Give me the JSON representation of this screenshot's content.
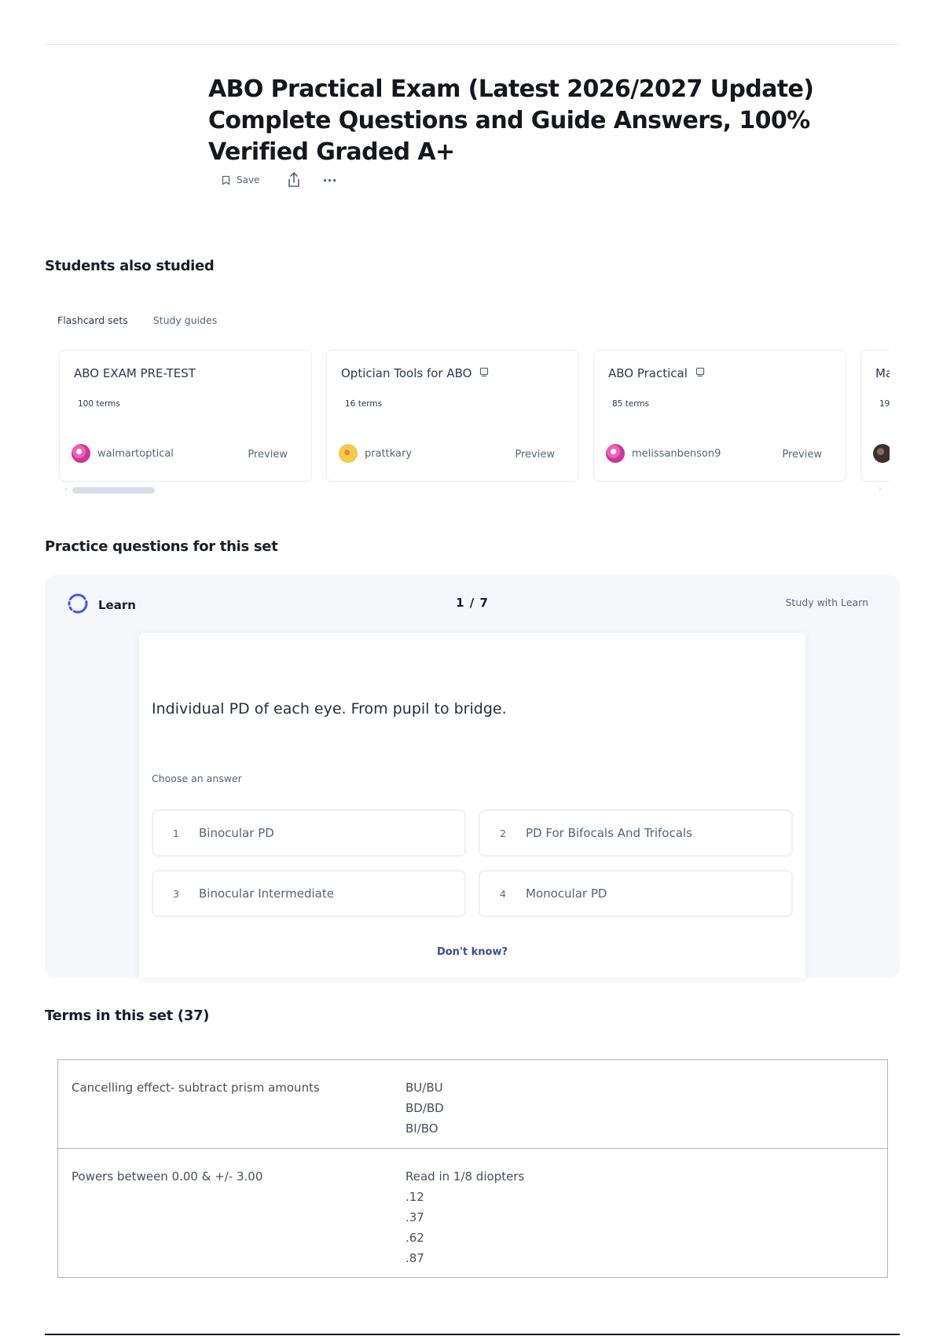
{
  "document": {
    "title": "ABO Practical Exam (Latest 2026/2027 Update) Complete Questions and Guide Answers, 100% Verified Graded A+"
  },
  "actions": {
    "save_label": "Save",
    "more_label": "···"
  },
  "students_also_studied": {
    "heading": "Students also studied",
    "tabs": [
      "Flashcard sets",
      "Study guides"
    ],
    "cards": [
      {
        "title": "ABO EXAM PRE-TEST",
        "terms": "100 terms",
        "user": "walmartoptical",
        "preview": "Preview"
      },
      {
        "title": "Optician Tools for ABO",
        "terms": "16 terms",
        "user": "prattkary",
        "preview": "Preview"
      },
      {
        "title": "ABO Practical",
        "terms": "85 terms",
        "user": "melissanbenson9",
        "preview": "Preview"
      },
      {
        "title": "Ma",
        "terms": "19",
        "user": "",
        "preview": ""
      }
    ]
  },
  "practice": {
    "heading": "Practice questions for this set",
    "mode_label": "Learn",
    "progress": "1 / 7",
    "study_link": "Study with Learn",
    "question": "Individual PD of each eye. From pupil to bridge.",
    "choose_label": "Choose an answer",
    "options": [
      {
        "num": "1",
        "label": "Binocular PD"
      },
      {
        "num": "2",
        "label": "PD For Bifocals And Trifocals"
      },
      {
        "num": "3",
        "label": "Binocular Intermediate"
      },
      {
        "num": "4",
        "label": "Monocular PD"
      }
    ],
    "dont_know": "Don't know?"
  },
  "terms": {
    "heading": "Terms in this set (37)",
    "rows": [
      {
        "term": "Cancelling effect- subtract prism amounts",
        "definition": [
          "BU/BU",
          "BD/BD",
          "BI/BO"
        ]
      },
      {
        "term": "Powers between 0.00 & +/- 3.00",
        "definition": [
          "Read in 1/8 diopters",
          ".12",
          ".37",
          ".62",
          ".87"
        ]
      }
    ]
  }
}
